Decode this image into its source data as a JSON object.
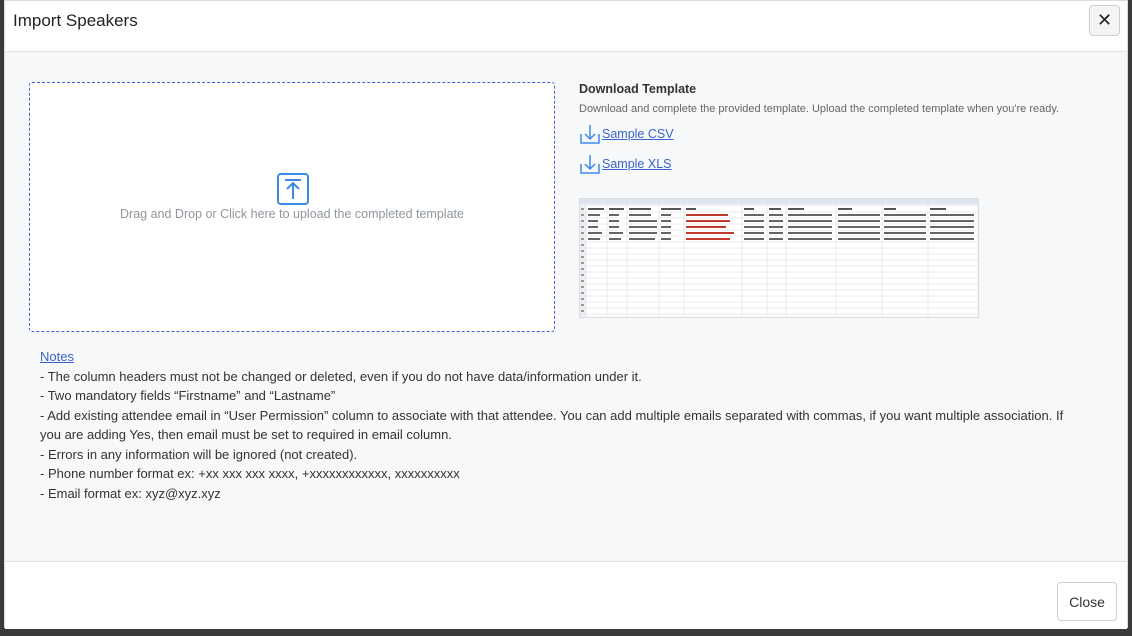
{
  "modal": {
    "title": "Import Speakers",
    "close_icon": "close-icon",
    "close_label": "Close"
  },
  "dropzone": {
    "icon": "upload-icon",
    "text": "Drag and Drop or Click here to upload the completed template"
  },
  "template": {
    "title": "Download Template",
    "description": "Download and complete the provided template. Upload the completed template when you're ready.",
    "links": [
      {
        "icon": "download-icon",
        "label": "Sample CSV"
      },
      {
        "icon": "download-icon",
        "label": "Sample XLS"
      }
    ],
    "preview_image": "template-spreadsheet-preview"
  },
  "notes": {
    "link_label": "Notes",
    "lines": [
      "- The column headers must not be changed or deleted, even if you do not have data/information under it.",
      "- Two mandatory fields “Firstname” and “Lastname”",
      "- Add existing attendee email in “User Permission” column to associate with that attendee. You can add multiple emails separated with commas, if you want multiple association. If you are adding Yes, then email must be set to required in email column.",
      "- Errors in any information will be ignored (not created).",
      "- Phone number format ex: +xx xxx xxx xxxx, +xxxxxxxxxxxx, xxxxxxxxxx",
      "- Email format ex: xyz@xyz.xyz"
    ]
  },
  "colors": {
    "link": "#3a64c8",
    "icon_blue": "#3b8be3",
    "dropzone_border": "#4a5bd4"
  }
}
